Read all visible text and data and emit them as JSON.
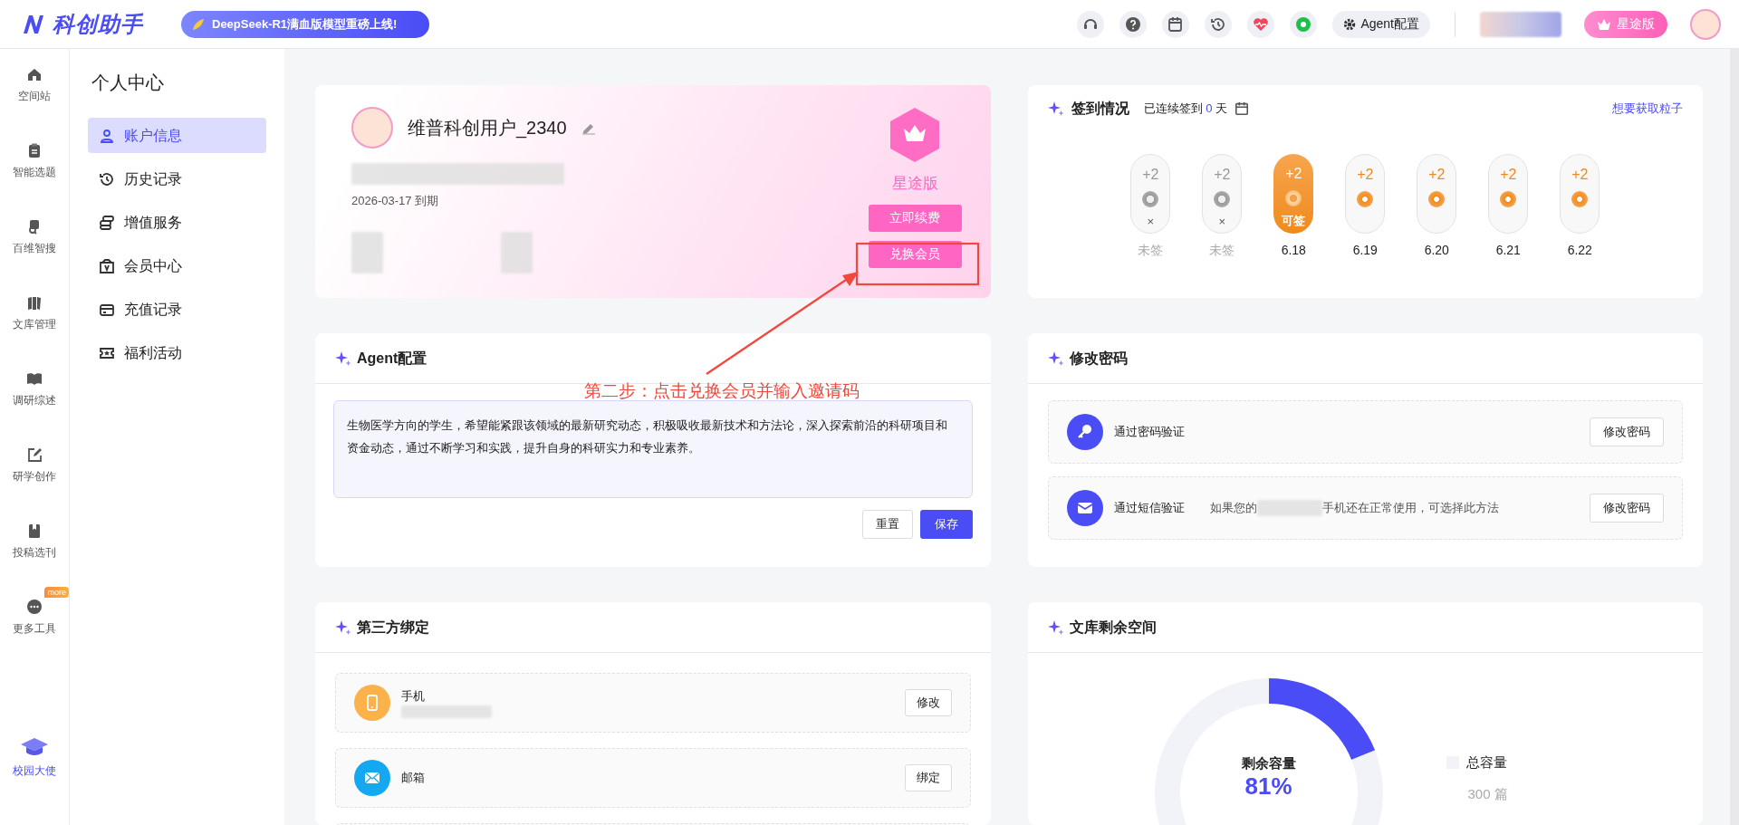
{
  "header": {
    "logo_text": "科创助手",
    "promo": "DeepSeek-R1满血版模型重磅上线!",
    "agent_button": "Agent配置",
    "plan_button": "星途版"
  },
  "rail": [
    {
      "label": "空间站"
    },
    {
      "label": "智能选题"
    },
    {
      "label": "百维智搜"
    },
    {
      "label": "文库管理"
    },
    {
      "label": "调研综述"
    },
    {
      "label": "研学创作"
    },
    {
      "label": "投稿选刊"
    },
    {
      "label": "更多工具",
      "badge": "more"
    }
  ],
  "rail_footer": {
    "label": "校园大使"
  },
  "menu": {
    "title": "个人中心",
    "items": [
      {
        "label": "账户信息",
        "selected": true
      },
      {
        "label": "历史记录",
        "selected": false
      },
      {
        "label": "增值服务",
        "selected": false
      },
      {
        "label": "会员中心",
        "selected": false
      },
      {
        "label": "充值记录",
        "selected": false
      },
      {
        "label": "福利活动",
        "selected": false
      }
    ]
  },
  "profile": {
    "name": "维普科创用户_2340",
    "expiry": "2026-03-17 到期",
    "plan": "星途版",
    "buttons": [
      "立即续费",
      "兑换会员"
    ]
  },
  "checkin": {
    "title": "签到情况",
    "streak_prefix": "已连续签到",
    "streak_count": "0",
    "streak_suffix": "天",
    "link": "想要获取粒子",
    "days": [
      {
        "points": "+2",
        "mark": "×",
        "label": "未签",
        "kind": "missed"
      },
      {
        "points": "+2",
        "mark": "×",
        "label": "未签",
        "kind": "missed"
      },
      {
        "points": "+2",
        "mark": "可签",
        "label": "6.18",
        "kind": "today"
      },
      {
        "points": "+2",
        "label": "6.19",
        "kind": "upcoming"
      },
      {
        "points": "+2",
        "label": "6.20",
        "kind": "upcoming"
      },
      {
        "points": "+2",
        "label": "6.21",
        "kind": "upcoming"
      },
      {
        "points": "+2",
        "label": "6.22",
        "kind": "upcoming"
      }
    ]
  },
  "agent": {
    "title": "Agent配置",
    "text": "生物医学方向的学生，希望能紧跟该领域的最新研究动态，积极吸收最新技术和方法论，深入探索前沿的科研项目和资金动态，通过不断学习和实践，提升自身的科研实力和专业素养。",
    "buttons": [
      {
        "label": "重置",
        "kind": "secondary"
      },
      {
        "label": "保存",
        "kind": "primary"
      }
    ]
  },
  "password": {
    "title": "修改密码",
    "methods": [
      {
        "label": "通过密码验证",
        "button": "修改密码"
      },
      {
        "label": "通过短信验证",
        "hint_before": "如果您的",
        "hint_after": "手机还在正常使用，可选择此方法",
        "button": "修改密码"
      }
    ]
  },
  "bindings": {
    "title": "第三方绑定",
    "items": [
      {
        "label": "手机",
        "button": "修改",
        "bound": true
      },
      {
        "label": "邮箱",
        "button": "绑定",
        "bound": false
      }
    ]
  },
  "storage": {
    "title": "文库剩余空间",
    "center_label": "剩余容量",
    "center_value": "81%",
    "chart_data": {
      "type": "donut",
      "values": [
        19,
        81
      ]
    },
    "legend": "总容量",
    "total": "300 篇"
  },
  "annotation": {
    "text": "第二步：点击兑换会员并输入邀请码"
  }
}
